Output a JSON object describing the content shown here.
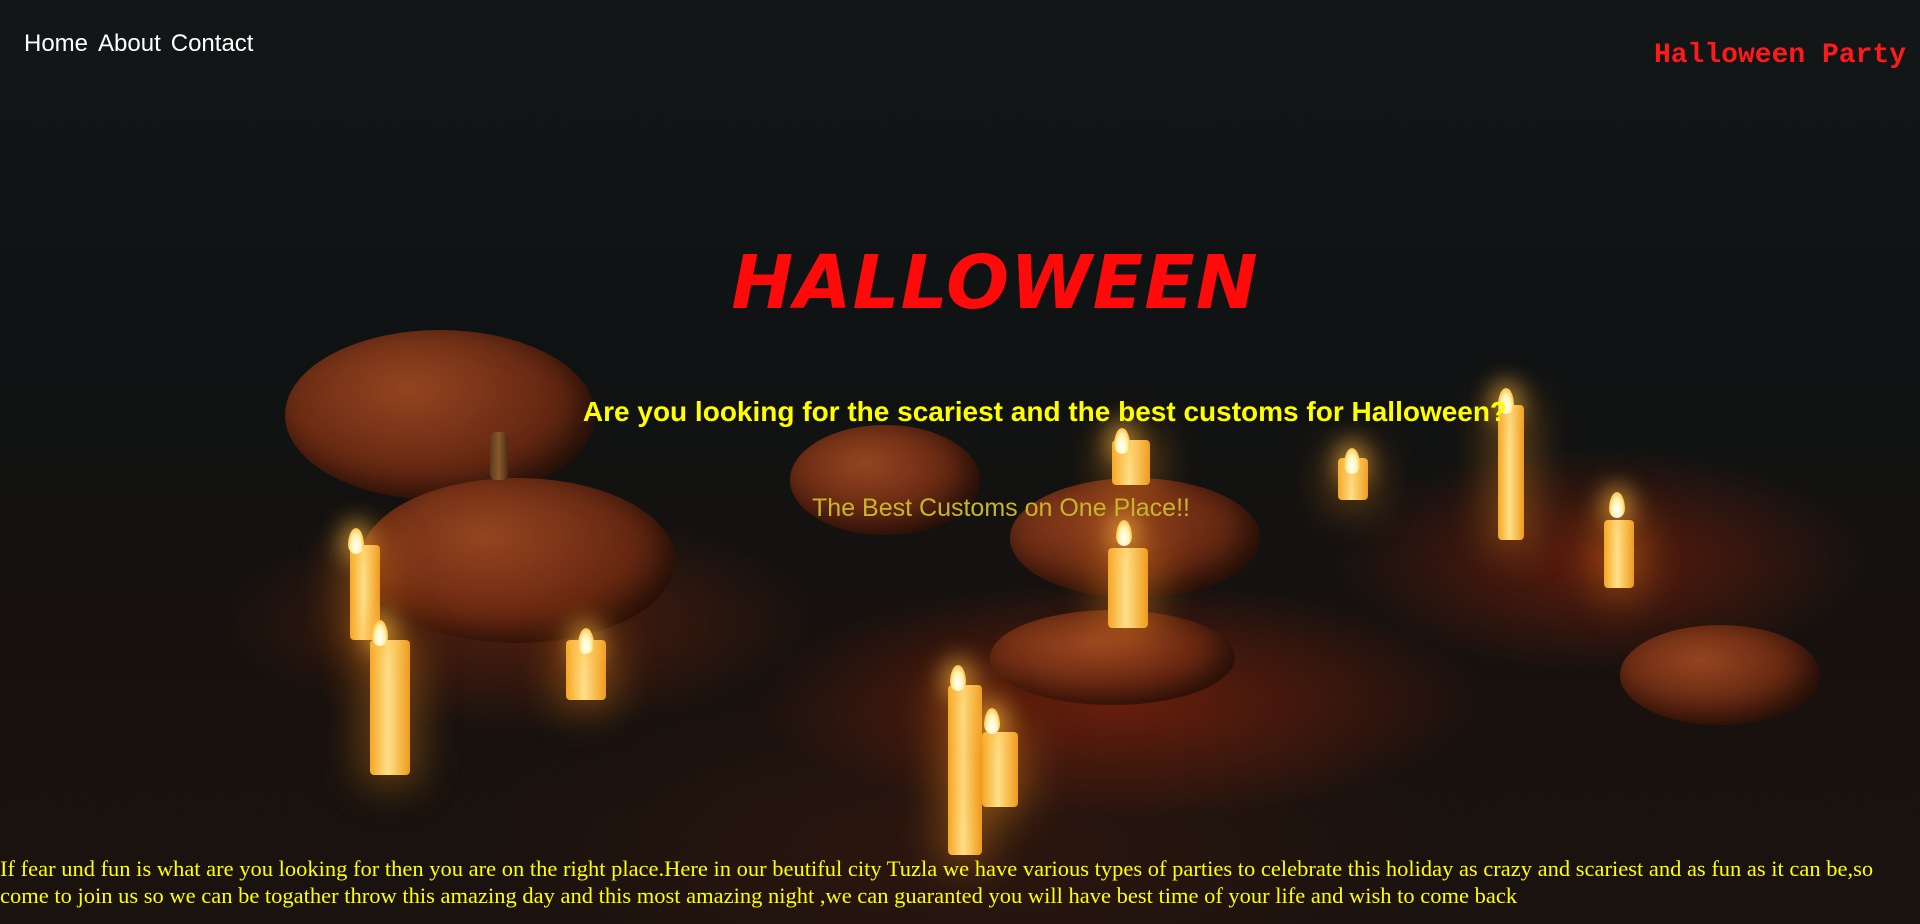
{
  "nav": {
    "items": [
      {
        "label": "Home"
      },
      {
        "label": "About"
      },
      {
        "label": "Contact"
      }
    ]
  },
  "brand": "Halloween Party",
  "hero": {
    "title": "HALLOWEEN",
    "subtitle": "Are you looking for the scariest and the best customs for Halloween?",
    "tagline": "The Best Customs on One Place!!"
  },
  "intro": {
    "text": "If fear und fun is what are you looking for then you are on the right place.Here in our beutiful city Tuzla we have various types of parties to celebrate this holiday as crazy and scariest and as fun as it can be,so come to join us so we can be togather throw this amazing day and this most amazing night ,we can guaranted you will have best time of your life and wish to come back"
  },
  "colors": {
    "title": "#ff0a0a",
    "subtitle": "#ffff00",
    "tagline": "#c9b52a",
    "brand": "#ff1a1a",
    "nav": "#ffffff"
  }
}
